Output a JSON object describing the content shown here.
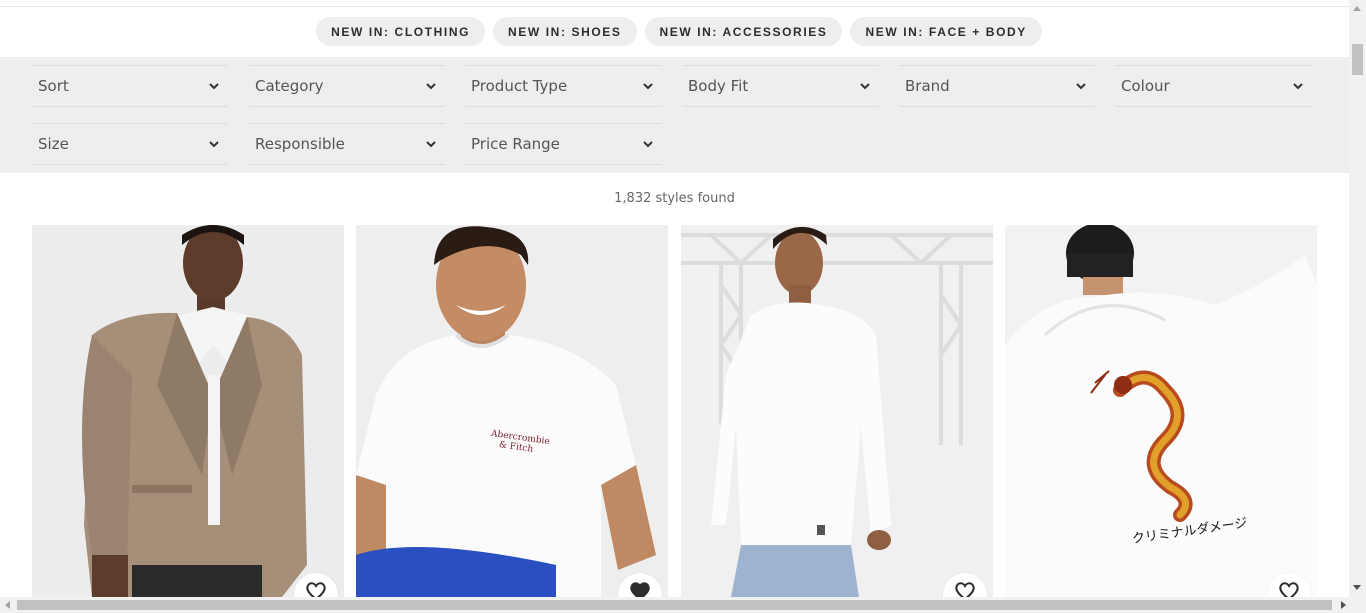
{
  "quick_links": [
    {
      "label": "NEW IN: CLOTHING"
    },
    {
      "label": "NEW IN: SHOES"
    },
    {
      "label": "NEW IN: ACCESSORIES"
    },
    {
      "label": "NEW IN: FACE + BODY"
    }
  ],
  "filters": [
    {
      "label": "Sort"
    },
    {
      "label": "Category"
    },
    {
      "label": "Product Type"
    },
    {
      "label": "Body Fit"
    },
    {
      "label": "Brand"
    },
    {
      "label": "Colour"
    },
    {
      "label": "Size"
    },
    {
      "label": "Responsible"
    },
    {
      "label": "Price Range"
    }
  ],
  "results": {
    "count_text": "1,832 styles found"
  },
  "products": [
    {
      "image": "man-in-beige-blazer",
      "saved": false
    },
    {
      "image": "man-in-white-tshirt-abercrombie",
      "brand_print": "Abercrombie & Fitch",
      "saved": true
    },
    {
      "image": "man-in-white-long-sleeve-top",
      "saved": false
    },
    {
      "image": "man-in-white-hoodie-dragon-print",
      "print_text": "クリミナルダメージ",
      "saved": false
    }
  ],
  "icons": {
    "dropdown": "chevron-down-icon",
    "save": "heart-icon"
  },
  "colors": {
    "filter_bg": "#eeeeee",
    "pill_bg": "#eeeeee",
    "text": "#2d2d2d"
  }
}
